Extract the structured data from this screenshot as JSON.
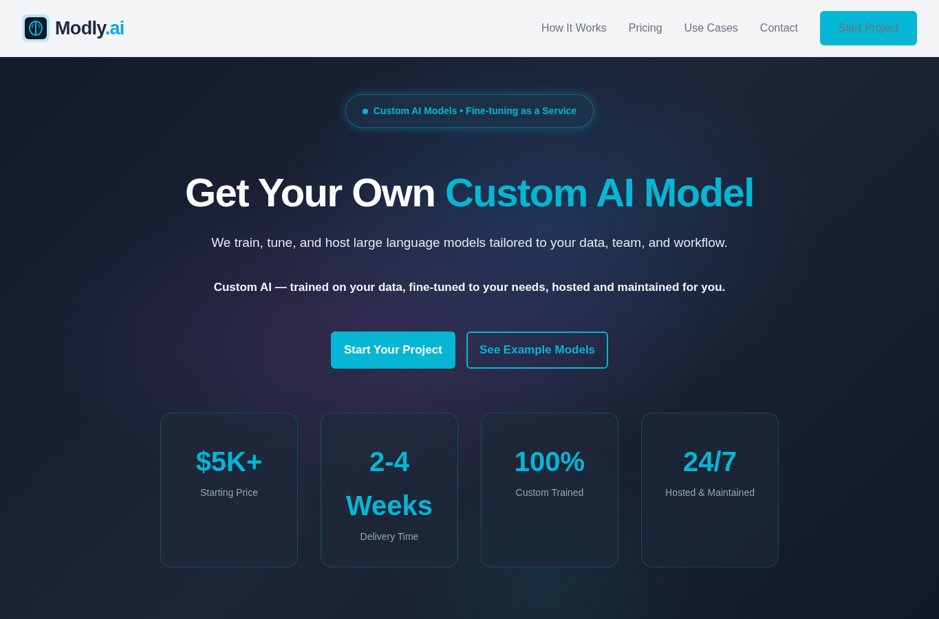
{
  "header": {
    "logo": {
      "name": "Modly",
      "suffix": ".ai"
    },
    "nav": [
      "How It Works",
      "Pricing",
      "Use Cases",
      "Contact"
    ],
    "cta": "Start Project"
  },
  "hero": {
    "badge": "Custom AI Models • Fine-tuning as a Service",
    "title": "Get Your Own",
    "title_highlight": "Custom AI Model",
    "subtitle": "We train, tune, and host large language models tailored to your data, team, and workflow.",
    "tagline": "Custom AI — trained on your data, fine-tuned to your needs, hosted and maintained for you.",
    "buttons": [
      {
        "label": "Start Your Project",
        "kind": "primary"
      },
      {
        "label": "See Example Models",
        "kind": "outline"
      }
    ]
  },
  "stats": [
    {
      "value": "$5K+",
      "label": "Starting Price"
    },
    {
      "value": "2-4 Weeks",
      "label": "Delivery Time"
    },
    {
      "value": "100%",
      "label": "Custom Trained"
    },
    {
      "value": "24/7",
      "label": "Hosted & Maintained"
    }
  ]
}
